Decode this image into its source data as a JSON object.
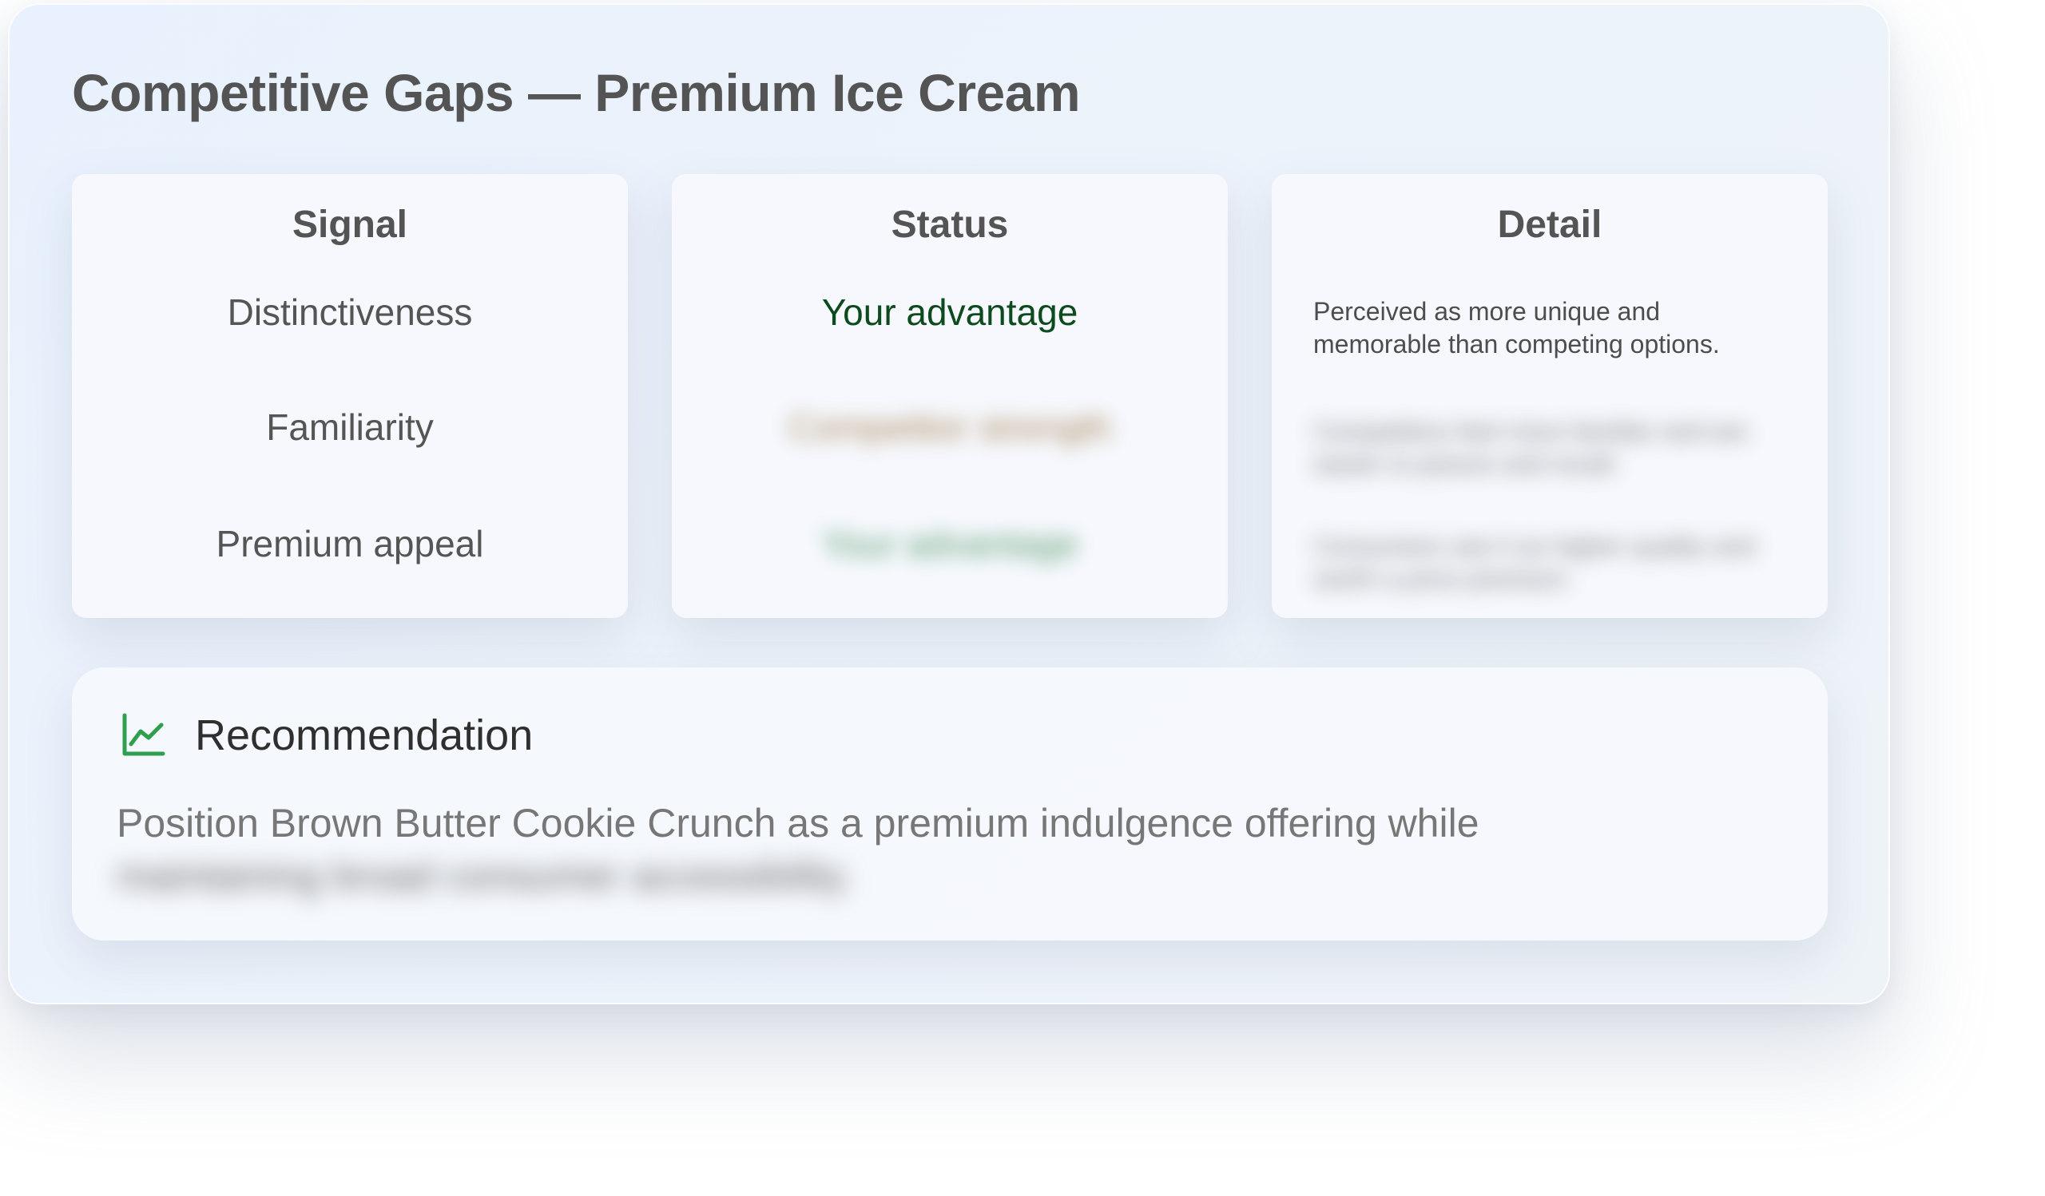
{
  "title": "Competitive Gaps — Premium Ice Cream",
  "table": {
    "headers": {
      "signal": "Signal",
      "status": "Status",
      "detail": "Detail"
    },
    "rows": [
      {
        "signal": "Distinctiveness",
        "status": "Your advantage",
        "status_color": "#0d4a1e",
        "detail": "Perceived as more unique and memorable than competing options."
      },
      {
        "signal": "Familiarity",
        "status": "Competitor strength",
        "status_color": "#9a7440",
        "detail": "Competitors feel more familiar and are easier to picture and recall."
      },
      {
        "signal": "Premium appeal",
        "status": "Your advantage",
        "status_color": "#3f8a55",
        "detail": "Consumers see it as higher quality and worth a price premium."
      }
    ]
  },
  "recommendation": {
    "icon": "line-chart-icon",
    "accent": "#2e9e4f",
    "title": "Recommendation",
    "line1": "Position Brown Butter Cookie Crunch as a premium indulgence offering while",
    "line2": "maintaining broad consumer accessibility."
  }
}
